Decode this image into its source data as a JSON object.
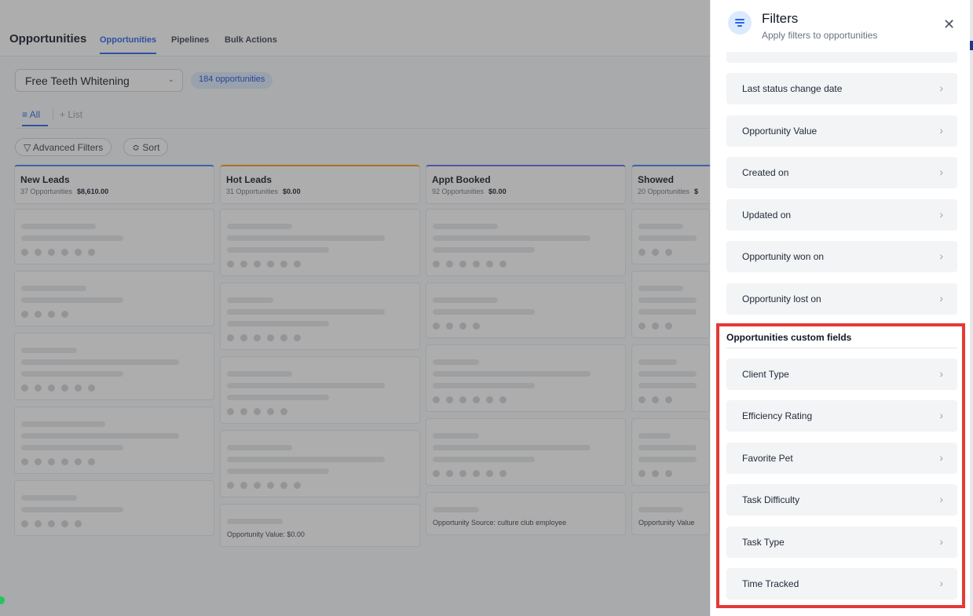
{
  "app": {
    "title": "Opportunities",
    "tabs": [
      {
        "label": "Opportunities",
        "active": true
      },
      {
        "label": "Pipelines",
        "active": false
      },
      {
        "label": "Bulk Actions",
        "active": false
      }
    ],
    "pipeline": {
      "selected": "Free Teeth Whitening"
    },
    "count_badge": "184 opportunities",
    "views": {
      "all": "≡ All",
      "add_list": "+ List"
    },
    "toolbar": {
      "advanced_filters": "▽ Advanced Filters",
      "sort": "≎ Sort"
    },
    "columns": [
      {
        "name": "New Leads",
        "count": "37 Opportunities",
        "value": "$8,610.00",
        "accent": "#3b82f6"
      },
      {
        "name": "Hot Leads",
        "count": "31 Opportunities",
        "value": "$0.00",
        "accent": "#f59e0b"
      },
      {
        "name": "Appt Booked",
        "count": "92 Opportunities",
        "value": "$0.00",
        "accent": "#6366f1"
      },
      {
        "name": "Showed",
        "count": "20 Opportunities",
        "value": "$",
        "accent": "#3b82f6"
      }
    ],
    "card_snippets": {
      "hot_leads_bottom": "Opportunity Value:  $0.00",
      "appt_booked_bottom": "Opportunity Source:  culture club employee",
      "showed_bottom": "Opportunity Value"
    }
  },
  "filters_panel": {
    "title": "Filters",
    "subtitle": "Apply filters to opportunities",
    "close_icon": "close-icon",
    "items": [
      {
        "label": "Last status change date"
      },
      {
        "label": "Opportunity Value"
      },
      {
        "label": "Created on"
      },
      {
        "label": "Updated on"
      },
      {
        "label": "Opportunity won on"
      },
      {
        "label": "Opportunity lost on"
      }
    ],
    "custom_section": {
      "title": "Opportunities custom fields",
      "items": [
        {
          "label": "Client Type"
        },
        {
          "label": "Efficiency Rating"
        },
        {
          "label": "Favorite Pet"
        },
        {
          "label": "Task Difficulty"
        },
        {
          "label": "Task Type"
        },
        {
          "label": "Time Tracked"
        }
      ]
    },
    "chevron": "›"
  },
  "colors": {
    "accent": "#2563eb",
    "highlight_border": "#e53935",
    "item_background": "#f3f4f6"
  }
}
